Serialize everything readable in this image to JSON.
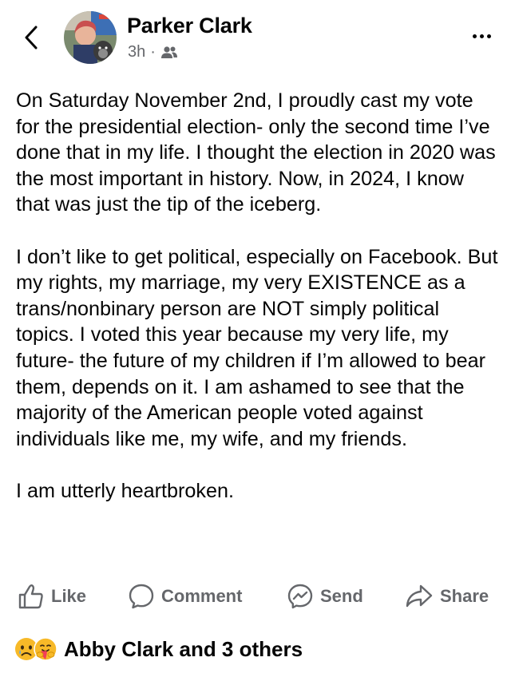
{
  "post": {
    "author": "Parker Clark",
    "time": "3h",
    "paragraphs": [
      "On Saturday November 2nd, I proudly cast my vote for the presidential election- only the second time I’ve done that in my life. I thought the election in 2020 was the most important in history. Now, in 2024, I know that was just the tip of the iceberg.",
      "I don’t like to get political, especially on Facebook. But my rights, my marriage, my very EXISTENCE as a trans/nonbinary person are NOT simply political topics. I voted this year because my very life, my future- the future of my children if I’m allowed to bear them, depends on it. I am ashamed to see that the majority of the American people voted against individuals like me, my wife, and my friends.",
      "I am utterly heartbroken."
    ]
  },
  "actions": {
    "like": "Like",
    "comment": "Comment",
    "send": "Send",
    "share": "Share"
  },
  "reactions": {
    "summary": "Abby Clark and 3 others",
    "icons": [
      "sad-face-icon",
      "care-hug-face-icon"
    ]
  },
  "icons": {
    "back": "chevron-left-icon",
    "more": "more-dots-icon",
    "audience": "friends-icon"
  },
  "colors": {
    "text": "#050505",
    "secondary": "#65676b",
    "reaction_yellow": "#f7b928"
  }
}
